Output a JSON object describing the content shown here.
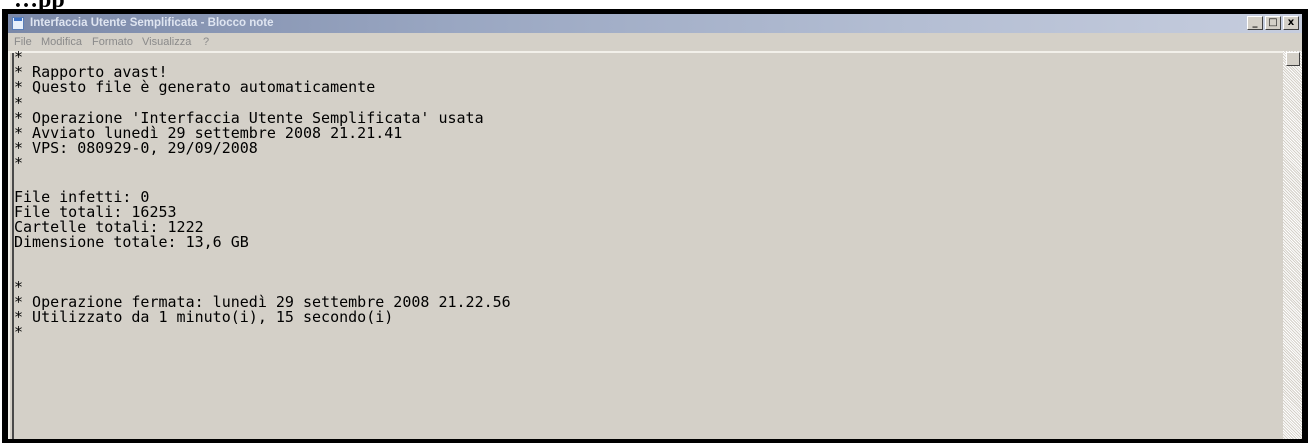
{
  "page": {
    "heading": "…pp"
  },
  "window": {
    "title": "Interfaccia Utente Semplificata - Blocco note",
    "controls": {
      "minimize": "_",
      "maximize": "□",
      "close": "x"
    }
  },
  "menu": {
    "items": [
      "File",
      "Modifica",
      "Formato",
      "Visualizza",
      "?"
    ]
  },
  "document": {
    "lines": [
      "*",
      "* Rapporto avast!",
      "* Questo file è generato automaticamente",
      "*",
      "* Operazione 'Interfaccia Utente Semplificata' usata",
      "* Avviato lunedì 29 settembre 2008 21.21.41",
      "* VPS: 080929-0, 29/09/2008",
      "*",
      "",
      "File infetti: 0",
      "File totali: 16253",
      "Cartelle totali: 1222",
      "Dimensione totale: 13,6 GB",
      "",
      "",
      "*",
      "* Operazione fermata: lunedì 29 settembre 2008 21.22.56",
      "* Utilizzato da 1 minuto(i), 15 secondo(i)",
      "*"
    ]
  },
  "icons": {
    "app": "notepad-icon"
  }
}
